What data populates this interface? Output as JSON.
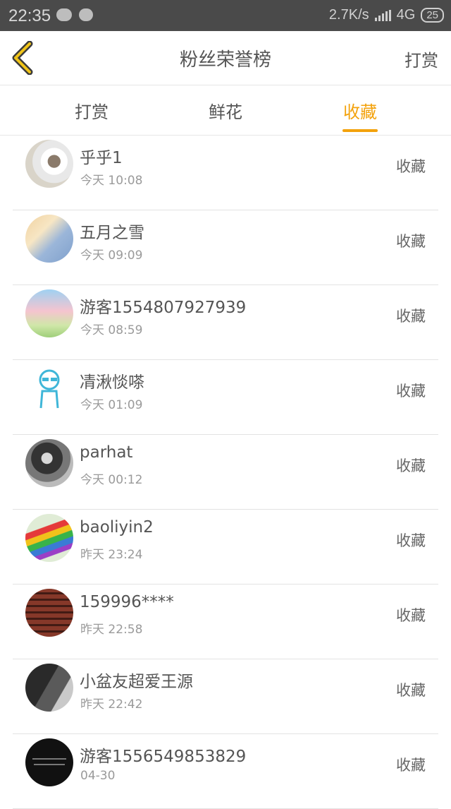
{
  "status": {
    "time": "22:35",
    "speed": "2.7K/s",
    "network": "4G",
    "battery": "25"
  },
  "header": {
    "title": "粉丝荣誉榜",
    "action": "打赏"
  },
  "tabs": [
    "打赏",
    "鲜花",
    "收藏"
  ],
  "active_tab": "收藏",
  "accent_color": "#f3a20c",
  "rows": [
    {
      "name": "乎乎1",
      "time": "今天 10:08",
      "tag": "收藏"
    },
    {
      "name": "五月之雪",
      "time": "今天 09:09",
      "tag": "收藏"
    },
    {
      "name": "游客1554807927939",
      "time": "今天 08:59",
      "tag": "收藏"
    },
    {
      "name": "凊湫惔嗏",
      "time": "今天 01:09",
      "tag": "收藏"
    },
    {
      "name": "parhat",
      "time": "今天 00:12",
      "tag": "收藏"
    },
    {
      "name": "baoliyin2",
      "time": "昨天 23:24",
      "tag": "收藏"
    },
    {
      "name": "159996****",
      "time": "昨天 22:58",
      "tag": "收藏"
    },
    {
      "name": "小盆友超爱王源",
      "time": "昨天 22:42",
      "tag": "收藏"
    },
    {
      "name": "游客1556549853829",
      "time": "04-30",
      "tag": "收藏"
    }
  ]
}
